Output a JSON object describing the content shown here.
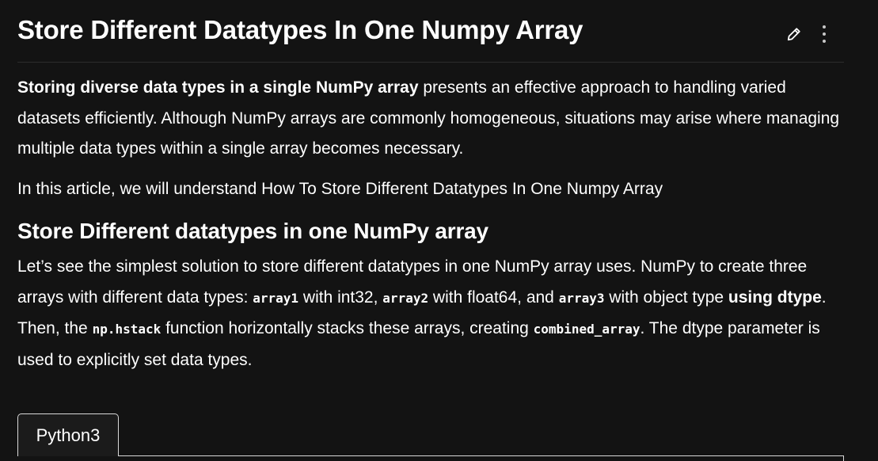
{
  "article": {
    "title": "Store Different Datatypes In One Numpy Array",
    "intro": {
      "bold": "Storing diverse data types in a single NumPy array",
      "rest": " presents an effective approach to handling varied datasets efficiently. Although NumPy arrays are commonly homogeneous, situations may arise where managing multiple data types within a single array becomes necessary."
    },
    "lead": "In this article, we will understand How To Store Different Datatypes In One Numpy Array",
    "section": {
      "heading": "Store Different datatypes in one NumPy array",
      "p1": "Let’s see the simplest solution to store different datatypes in one NumPy array uses. NumPy to create three arrays with different data types: ",
      "code1": "array1",
      "p2": " with int32, ",
      "code2": "array2",
      "p3": " with float64, and ",
      "code3": "array3",
      "p4": " with object type ",
      "bold1": "using dtype",
      "p5": ". Then, the ",
      "code4": "np.hstack",
      "p6": " function horizontally stacks these arrays, creating ",
      "code5": "combined_array",
      "p7": ". The dtype parameter is used to explicitly set data types."
    }
  },
  "header_actions": {
    "edit_icon": "pencil-icon",
    "more_icon": "kebab-menu-icon"
  },
  "code_tabs": [
    {
      "label": "Python3"
    }
  ],
  "colors": {
    "background": "#131313",
    "text": "#ffffff",
    "divider": "#2c2c2c",
    "tab_border": "#d9d9d9"
  }
}
